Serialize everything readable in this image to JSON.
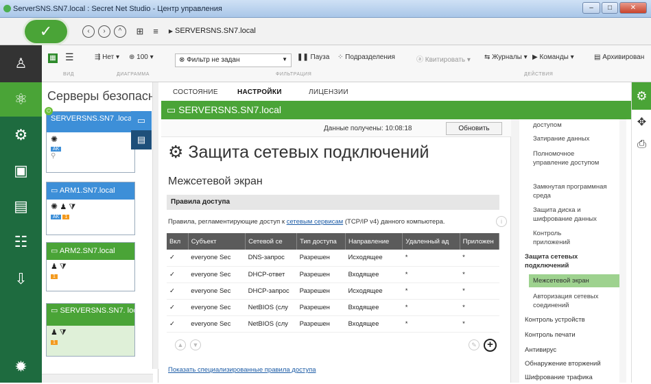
{
  "window": {
    "title": "ServerSNS.SN7.local : Secret Net Studio - Центр управления"
  },
  "nav": {
    "address": "SERVERSNS.SN7.local"
  },
  "ribbon": {
    "no_label": "Нет",
    "zoom": "100",
    "filter_placeholder": "Фильтр не задан",
    "pause": "Пауза",
    "subdivisions": "Подразделения",
    "acknowledge": "Квитировать",
    "logs": "Журналы",
    "commands": "Команды",
    "archive": "Архивирован",
    "group_view": "ВИД",
    "group_chart": "ДИАГРАММА",
    "group_filter": "ФИЛЬТРАЦИЯ",
    "group_actions": "ДЕЙСТВИЯ"
  },
  "left": {
    "title": "Серверы безопасн",
    "servers": [
      {
        "name": "SERVERSNS.SN7 .local",
        "tag": "AK"
      },
      {
        "name": "ARM1.SN7.local",
        "tag": "AK",
        "count": "1"
      },
      {
        "name": "ARM2.SN7.local",
        "count": "1"
      },
      {
        "name": "SERVERSNS.SN7. local",
        "count": "1"
      }
    ]
  },
  "tabs": [
    "СОСТОЯНИЕ",
    "НАСТРОЙКИ",
    "ЛИЦЕНЗИИ"
  ],
  "header": {
    "server": "SERVERSNS.SN7.local"
  },
  "status": {
    "received": "Данные получены: 10:08:18",
    "refresh": "Обновить"
  },
  "main": {
    "title": "Защита сетевых подключений",
    "subtitle": "Межсетевой экран",
    "rules_title": "Правила доступа",
    "desc_pre": "Правила, регламентирующие доступ к ",
    "desc_link": "сетевым сервисам",
    "desc_post": " (TCP/IP v4) данного компьютера.",
    "show_link": "Показать специализированные правила доступа"
  },
  "table": {
    "columns": [
      "Вкл",
      "Субъект",
      "Сетевой се",
      "Тип доступа",
      "Направление",
      "Удаленный ад",
      "Приложен"
    ],
    "rows": [
      {
        "on": "✓",
        "subject": "everyone Sec",
        "service": "DNS-запрос",
        "access": "Разрешен",
        "direction": "Исходящее",
        "remote": "*",
        "app": "*"
      },
      {
        "on": "✓",
        "subject": "everyone Sec",
        "service": "DHCP-ответ",
        "access": "Разрешен",
        "direction": "Входящее",
        "remote": "*",
        "app": "*"
      },
      {
        "on": "✓",
        "subject": "everyone Sec",
        "service": "DHCP-запрос",
        "access": "Разрешен",
        "direction": "Исходящее",
        "remote": "*",
        "app": "*"
      },
      {
        "on": "✓",
        "subject": "everyone Sec",
        "service": "NetBIOS (слу",
        "access": "Разрешен",
        "direction": "Входящее",
        "remote": "*",
        "app": "*"
      },
      {
        "on": "✓",
        "subject": "everyone Sec",
        "service": "NetBIOS (слу",
        "access": "Разрешен",
        "direction": "Входящее",
        "remote": "*",
        "app": "*"
      }
    ]
  },
  "rightnav": {
    "items": [
      "доступом",
      "Затирание данных",
      "Полномочное управление доступом",
      "Замкнутая программная среда",
      "Защита диска и шифрование данных",
      "Контроль приложений",
      "Защита сетевых подключений",
      "Межсетевой экран",
      "Авторизация сетевых соединений",
      "Контроль устройств",
      "Контроль печати",
      "Антивирус",
      "Обнаружение вторжений",
      "Шифрование трафика"
    ]
  },
  "colors": {
    "accent": "#4aa437",
    "dark": "#1e6b3f",
    "blue": "#3d8fd8"
  }
}
